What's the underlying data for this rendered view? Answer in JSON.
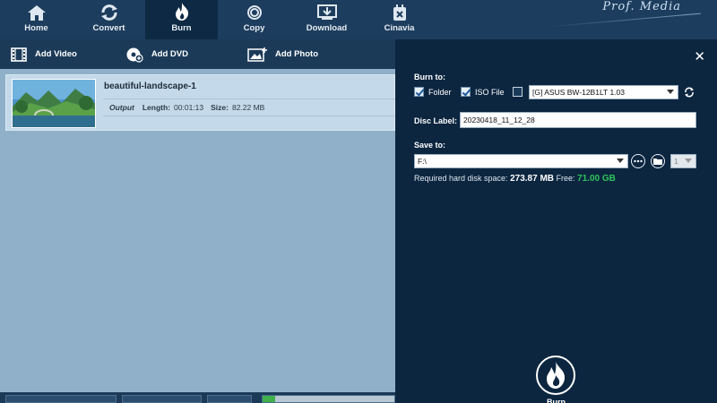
{
  "nav": {
    "items": [
      {
        "label": "Home",
        "icon": "home-icon"
      },
      {
        "label": "Convert",
        "icon": "convert-icon"
      },
      {
        "label": "Burn",
        "icon": "flame-icon",
        "active": true
      },
      {
        "label": "Copy",
        "icon": "disc-copy-icon"
      },
      {
        "label": "Download",
        "icon": "download-icon"
      },
      {
        "label": "Cinavia",
        "icon": "cinavia-icon"
      }
    ],
    "brand": "Prof. Media"
  },
  "toolbar": {
    "add_video": "Add Video",
    "add_dvd": "Add DVD",
    "add_photo": "Add Photo"
  },
  "list": {
    "items": [
      {
        "title": "beautiful-landscape-1",
        "output_label": "Output",
        "length_label": "Length:",
        "length": "00:01:13",
        "size_label": "Size:",
        "size": "82.22 MB"
      }
    ]
  },
  "panel": {
    "burn_to_label": "Burn to:",
    "folder_label": "Folder",
    "folder_checked": true,
    "iso_label": "ISO File",
    "iso_checked": true,
    "drive_checked": false,
    "drive_value": "[G] ASUS BW-12B1LT 1.03",
    "disc_label_label": "Disc Label:",
    "disc_label_value": "20230418_11_12_28",
    "save_to_label": "Save to:",
    "save_to_value": "F:\\",
    "copies_value": "1",
    "space_label": "Required hard disk space:",
    "space_value": "273.87 MB",
    "free_label": "Free:",
    "free_value": "71.00 GB",
    "burn_button_label": "Burn"
  },
  "colors": {
    "nav_bg": "#1d3d5e",
    "nav_active": "#0d2944",
    "panel_bg": "#0c2640",
    "list_bg": "#8fb0c8",
    "row_bg": "#c4d9e9",
    "free_green": "#2ec45a"
  }
}
